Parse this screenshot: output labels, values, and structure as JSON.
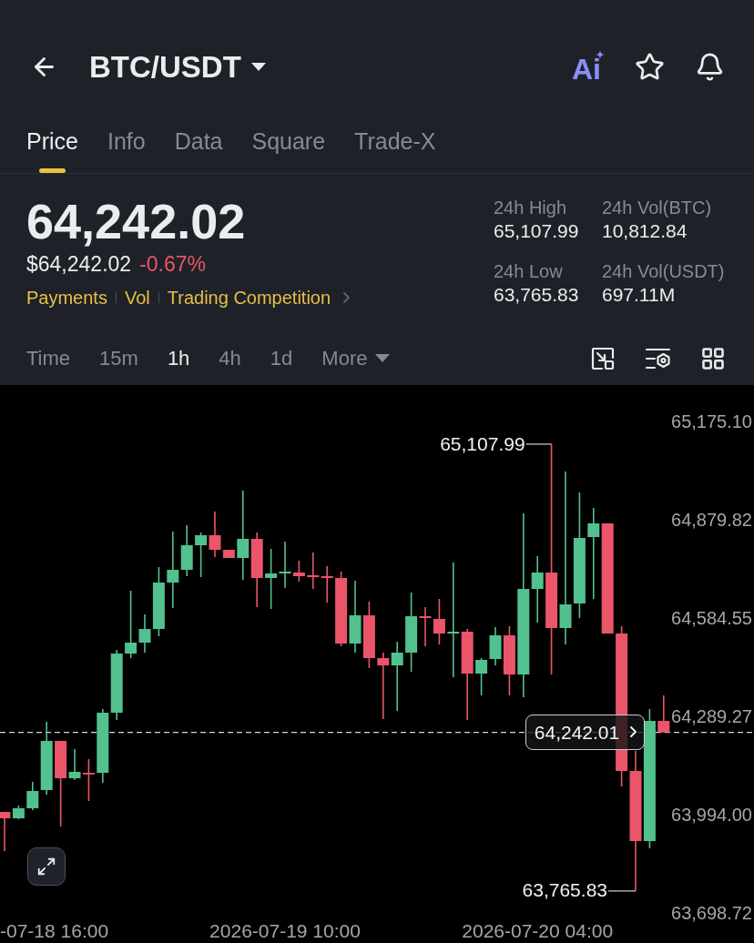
{
  "header": {
    "title": "BTC/USDT",
    "ai_button": "Ai"
  },
  "tabs": [
    {
      "label": "Price",
      "selected": true
    },
    {
      "label": "Info",
      "selected": false
    },
    {
      "label": "Data",
      "selected": false
    },
    {
      "label": "Square",
      "selected": false
    },
    {
      "label": "Trade-X",
      "selected": false
    }
  ],
  "ticker": {
    "last_price": "64,242.02",
    "usd_price": "$64,242.02",
    "change": "-0.67%",
    "links": [
      "Payments",
      "Vol",
      "Trading Competition"
    ]
  },
  "stats": [
    {
      "label": "24h High",
      "value": "65,107.99"
    },
    {
      "label": "24h Vol(BTC)",
      "value": "10,812.84"
    },
    {
      "label": "24h Low",
      "value": "63,765.83"
    },
    {
      "label": "24h Vol(USDT)",
      "value": "697.11M"
    }
  ],
  "intervals": [
    {
      "label": "Time",
      "kind": "option",
      "selected": false
    },
    {
      "label": "15m",
      "kind": "option",
      "selected": false
    },
    {
      "label": "1h",
      "kind": "option",
      "selected": true
    },
    {
      "label": "4h",
      "kind": "option",
      "selected": false
    },
    {
      "label": "1d",
      "kind": "option",
      "selected": false
    },
    {
      "label": "More",
      "kind": "menu",
      "selected": false
    }
  ],
  "chart": {
    "chart_data": {
      "type": "candlestick",
      "categories": [
        null,
        null,
        null,
        null,
        null,
        null,
        null,
        null,
        null,
        null,
        null,
        null,
        null,
        null,
        null,
        null,
        null,
        null,
        null,
        null,
        "2026-07-19 10:00",
        null,
        null,
        null,
        null,
        null,
        null,
        null,
        null,
        null,
        null,
        null,
        null,
        null,
        null,
        null,
        null,
        null,
        "2026-07-20 04:00",
        null,
        null,
        null,
        null,
        null,
        null,
        null,
        null,
        null
      ],
      "ohlc": [
        [
          64003.29,
          64003.29,
          63885.73,
          63984.15
        ],
        [
          63984.15,
          64022.43,
          63981.42,
          64014.23
        ],
        [
          64014.23,
          64093.51,
          64008.76,
          64066.17
        ],
        [
          64068.91,
          64273.96,
          64055.24,
          64216.55
        ],
        [
          64216.55,
          64216.55,
          63959.55,
          64104.45
        ],
        [
          64104.45,
          64191.94,
          64098.98,
          64123.59
        ],
        [
          64120.85,
          64161.87,
          64036.1,
          64118.12
        ],
        [
          64120.85,
          64312.24,
          64090.78,
          64301.3
        ],
        [
          64301.3,
          64489.95,
          64279.43,
          64479.01
        ],
        [
          64479.01,
          64667.66,
          64465.34,
          64511.82
        ],
        [
          64511.82,
          64596.58,
          64481.75,
          64552.83
        ],
        [
          64552.83,
          64738.75,
          64530.96,
          64692.27
        ],
        [
          64692.27,
          64845.38,
          64615.72,
          64730.55
        ],
        [
          64730.55,
          64864.51,
          64711.41,
          64804.36
        ],
        [
          64804.36,
          64842.64,
          64708.67,
          64834.44
        ],
        [
          64834.44,
          64905.52,
          64768.82,
          64790.69
        ],
        [
          64790.69,
          64790.69,
          64766.09,
          64766.09
        ],
        [
          64766.09,
          64968.41,
          64700.47,
          64823.5
        ],
        [
          64823.5,
          64842.64,
          64618.45,
          64705.94
        ],
        [
          64705.94,
          64793.43,
          64612.98,
          64719.61
        ],
        [
          64719.61,
          64815.3,
          64675.86,
          64725.08
        ],
        [
          64722.34,
          64757.89,
          64695.0,
          64711.41
        ],
        [
          64714.14,
          64782.49,
          64673.13,
          64708.67
        ],
        [
          64711.41,
          64741.48,
          64632.12,
          64705.94
        ],
        [
          64705.94,
          64725.08,
          64500.89,
          64509.09
        ],
        [
          64509.09,
          64697.74,
          64481.75,
          64593.84
        ],
        [
          64593.84,
          64634.85,
          64435.27,
          64465.34
        ],
        [
          64465.34,
          64481.75,
          64282.16,
          64443.47
        ],
        [
          64443.47,
          64514.56,
          64306.77,
          64481.75
        ],
        [
          64481.75,
          64662.19,
          64424.33,
          64591.11
        ],
        [
          64591.11,
          64618.45,
          64500.89,
          64585.64
        ],
        [
          64582.91,
          64643.06,
          64506.35,
          64539.16
        ],
        [
          64539.16,
          64752.42,
          64407.93,
          64544.63
        ],
        [
          64544.63,
          64552.83,
          64279.43,
          64418.86
        ],
        [
          64418.86,
          64465.34,
          64353.25,
          64459.88
        ],
        [
          64462.61,
          64558.3,
          64443.47,
          64533.69
        ],
        [
          64533.69,
          64561.04,
          64353.25,
          64416.13
        ],
        [
          64416.13,
          64900.06,
          64347.78,
          64673.13
        ],
        [
          64673.13,
          64771.56,
          64571.97,
          64722.34
        ],
        [
          64722.34,
          65107.99,
          64416.13,
          64555.57
        ],
        [
          64555.57,
          65025.82,
          64506.35,
          64626.65
        ],
        [
          64629.39,
          64962.94,
          64585.64,
          64826.24
        ],
        [
          64828.97,
          64916.46,
          64643.06,
          64869.98
        ],
        [
          64869.98,
          64869.98,
          64539.16,
          64539.16
        ],
        [
          64539.16,
          64561.04,
          64079.84,
          64126.32
        ],
        [
          64126.32,
          64186.47,
          63765.83,
          63915.8
        ],
        [
          63915.8,
          64312.24,
          63893.93,
          64276.69
        ],
        [
          64276.69,
          64353.25,
          64242.01,
          64242.01
        ]
      ],
      "ylim": [
        63606.86,
        65285.55
      ],
      "yticks": [
        {
          "value": 65175.1,
          "label": "65,175.10"
        },
        {
          "value": 64879.82,
          "label": "64,879.82"
        },
        {
          "value": 64584.55,
          "label": "64,584.55"
        },
        {
          "value": 64289.27,
          "label": "64,289.27"
        },
        {
          "value": 63994.0,
          "label": "63,994.00"
        },
        {
          "value": 63698.72,
          "label": "63,698.72"
        }
      ],
      "ref_lines": [
        {
          "axis": "y",
          "value": 64242.01,
          "label": "64,242.01"
        }
      ]
    },
    "edge_time_label": "-07-18 16:00",
    "high_label": "65,107.99",
    "low_label": "63,765.83"
  }
}
